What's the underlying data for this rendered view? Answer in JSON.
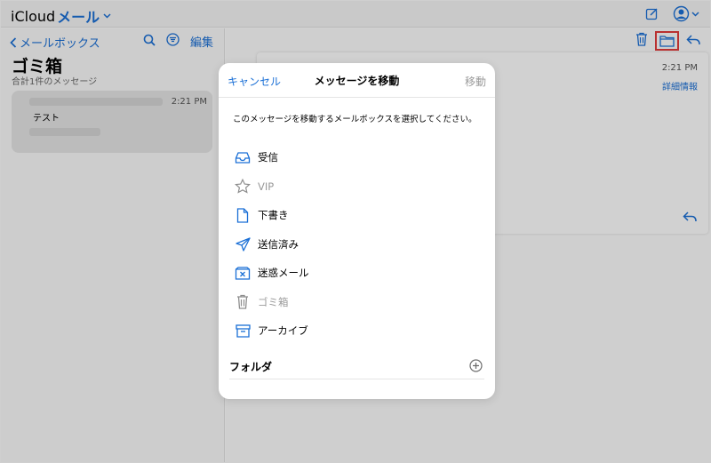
{
  "app": {
    "brand_main": "iCloud",
    "brand_mail": "メール",
    "brand_chevron": "⌄"
  },
  "sidebar": {
    "back_label": "メールボックス",
    "edit_label": "編集",
    "title": "ゴミ箱",
    "subtitle": "合計1件のメッセージ",
    "message": {
      "time": "2:21 PM",
      "subject": "テスト"
    }
  },
  "reader": {
    "time": "2:21 PM",
    "detail_link": "詳細情報"
  },
  "modal": {
    "cancel": "キャンセル",
    "title": "メッセージを移動",
    "move": "移動",
    "instruction": "このメッセージを移動するメールボックスを選択してください。",
    "mailboxes": [
      {
        "label": "受信",
        "icon": "inbox-icon",
        "disabled": false
      },
      {
        "label": "VIP",
        "icon": "star-icon",
        "disabled": true
      },
      {
        "label": "下書き",
        "icon": "document-icon",
        "disabled": false
      },
      {
        "label": "送信済み",
        "icon": "paperplane-icon",
        "disabled": false
      },
      {
        "label": "迷惑メール",
        "icon": "junk-icon",
        "disabled": false
      },
      {
        "label": "ゴミ箱",
        "icon": "trash-icon",
        "disabled": true
      },
      {
        "label": "アーカイブ",
        "icon": "archive-icon",
        "disabled": false
      }
    ],
    "folder_heading": "フォルダ"
  },
  "colors": {
    "accent": "#1a6fd6",
    "highlight": "#e23b3b",
    "disabled_text": "#9a9a9a"
  }
}
